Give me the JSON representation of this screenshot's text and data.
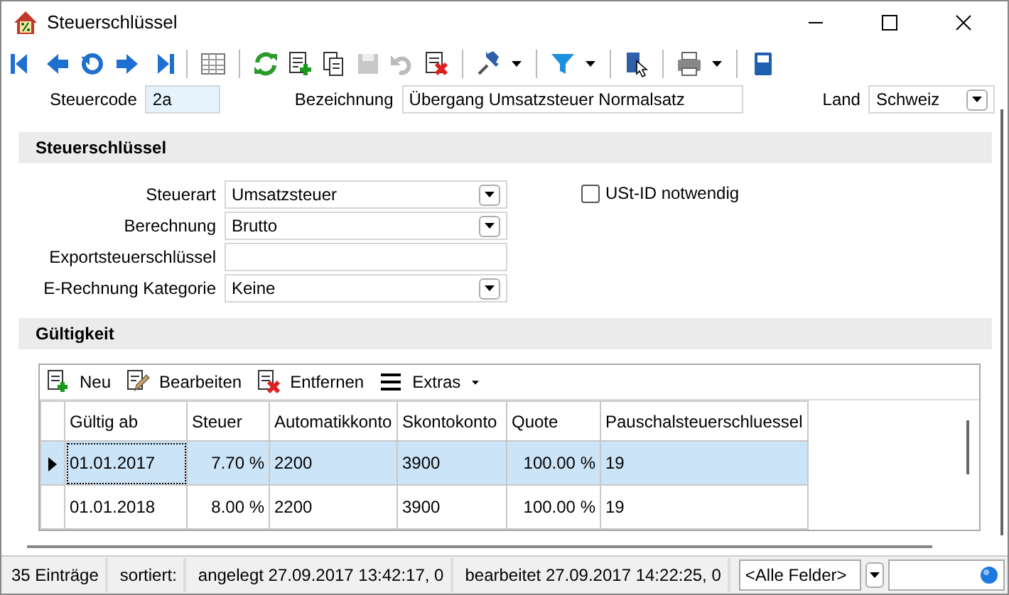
{
  "window": {
    "title": "Steuerschlüssel"
  },
  "header_fields": [
    {
      "label": "Steuercode",
      "kind": "text",
      "value": "2a",
      "highlighted": true
    },
    {
      "label": "Bezeichnung",
      "kind": "text",
      "value": "Übergang Umsatzsteuer Normalsatz",
      "highlighted": false
    },
    {
      "label": "Land",
      "kind": "select",
      "value": "Schweiz",
      "highlighted": false
    }
  ],
  "sections": [
    {
      "title": "Steuerschlüssel"
    },
    {
      "title": "Gültigkeit"
    }
  ],
  "tax_fields": [
    {
      "label": "Steuerart",
      "kind": "select",
      "value": "Umsatzsteuer"
    },
    {
      "label": "Berechnung",
      "kind": "select",
      "value": "Brutto"
    },
    {
      "label": "Exportsteuerschlüssel",
      "kind": "text"
    },
    {
      "label": "E-Rechnung Kategorie",
      "kind": "select",
      "value": "Keine"
    }
  ],
  "checkbox": {
    "label": "USt-ID notwendig",
    "checked": false
  },
  "grid_toolbar": [
    {
      "label": "Neu",
      "kind": "new"
    },
    {
      "label": "Bearbeiten",
      "kind": "edit"
    },
    {
      "label": "Entfernen",
      "kind": "delete"
    },
    {
      "label": "Extras",
      "kind": "menu"
    }
  ],
  "table": {
    "columns": [
      "Gültig ab",
      "Steuer",
      "Automatikkonto",
      "Skontokonto",
      "Quote",
      "Pauschalsteuerschluessel"
    ],
    "rows": [
      {
        "cells": [
          "01.01.2017",
          "7.70 %",
          "2200",
          "3900",
          "100.00 %",
          "19"
        ],
        "selected": true
      },
      {
        "cells": [
          "01.01.2018",
          "8.00 %",
          "2200",
          "3900",
          "100.00 %",
          "19"
        ],
        "selected": false
      }
    ]
  },
  "status_bar": {
    "segments": [
      "35 Einträge",
      "sortiert:",
      "angelegt 27.09.2017 13:42:17,  0",
      "bearbeitet 27.09.2017 14:22:25,  0"
    ],
    "field_filter": "<Alle Felder>"
  }
}
